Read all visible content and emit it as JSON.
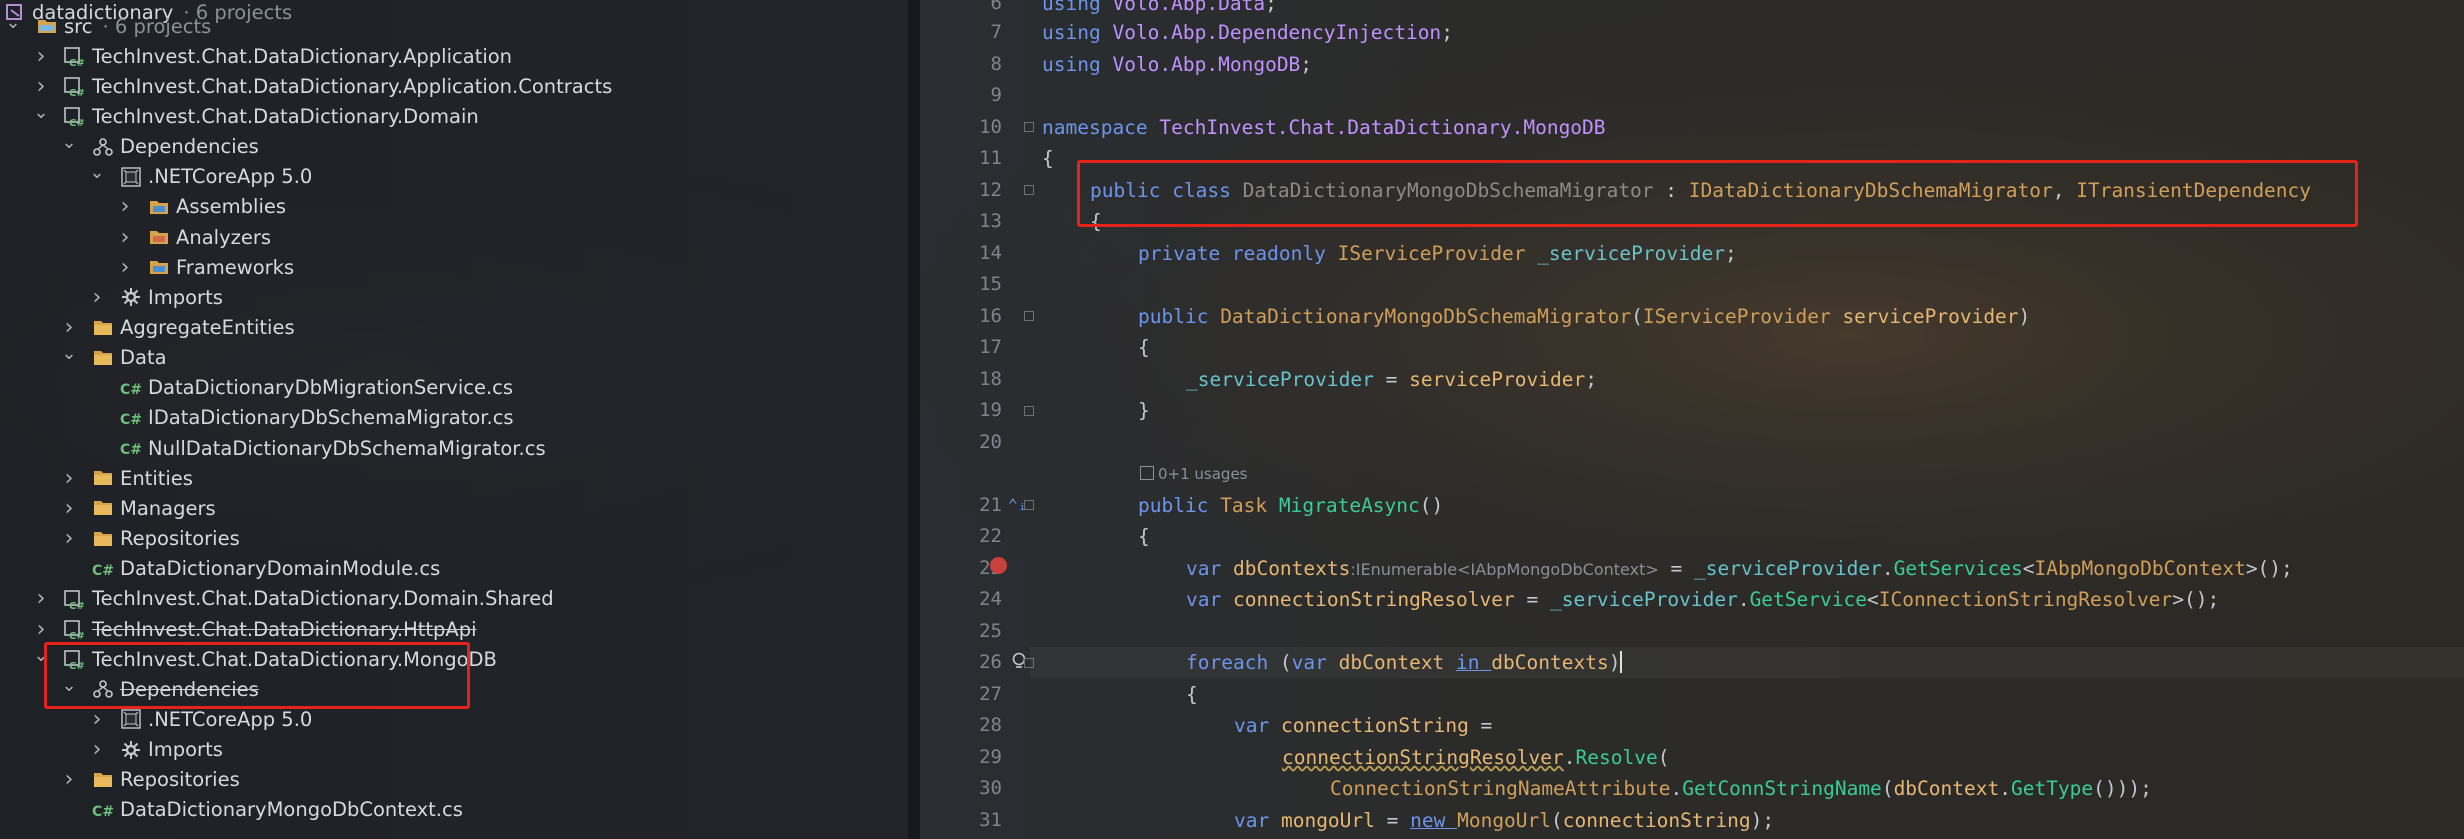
{
  "tree": {
    "root": {
      "label": "datadictionary",
      "count": "· 6 projects"
    },
    "rows": [
      {
        "indent": 0,
        "arrow": "down",
        "icon": "folder-src-icon",
        "label": "src",
        "meta": "· 6 projects"
      },
      {
        "indent": 1,
        "arrow": "right",
        "icon": "csharp-project-icon",
        "label": "TechInvest.Chat.DataDictionary.Application"
      },
      {
        "indent": 1,
        "arrow": "right",
        "icon": "csharp-project-icon",
        "label": "TechInvest.Chat.DataDictionary.Application.Contracts"
      },
      {
        "indent": 1,
        "arrow": "down",
        "icon": "csharp-project-icon",
        "label": "TechInvest.Chat.DataDictionary.Domain"
      },
      {
        "indent": 2,
        "arrow": "down",
        "icon": "dependencies-icon",
        "label": "Dependencies"
      },
      {
        "indent": 3,
        "arrow": "down",
        "icon": "netcore-icon",
        "label": ".NETCoreApp 5.0"
      },
      {
        "indent": 4,
        "arrow": "right",
        "icon": "assemblies-icon",
        "label": "Assemblies"
      },
      {
        "indent": 4,
        "arrow": "right",
        "icon": "analyzers-icon",
        "label": "Analyzers"
      },
      {
        "indent": 4,
        "arrow": "right",
        "icon": "frameworks-icon",
        "label": "Frameworks"
      },
      {
        "indent": 3,
        "arrow": "right",
        "icon": "imports-gear-icon",
        "label": "Imports"
      },
      {
        "indent": 2,
        "arrow": "right",
        "icon": "folder-icon",
        "label": "AggregateEntities"
      },
      {
        "indent": 2,
        "arrow": "down",
        "icon": "folder-icon",
        "label": "Data"
      },
      {
        "indent": 3,
        "arrow": "none",
        "icon": "csharp-file-icon",
        "label": "DataDictionaryDbMigrationService.cs"
      },
      {
        "indent": 3,
        "arrow": "none",
        "icon": "csharp-file-icon",
        "label": "IDataDictionaryDbSchemaMigrator.cs"
      },
      {
        "indent": 3,
        "arrow": "none",
        "icon": "csharp-file-icon",
        "label": "NullDataDictionaryDbSchemaMigrator.cs"
      },
      {
        "indent": 2,
        "arrow": "right",
        "icon": "folder-icon",
        "label": "Entities"
      },
      {
        "indent": 2,
        "arrow": "right",
        "icon": "folder-icon",
        "label": "Managers"
      },
      {
        "indent": 2,
        "arrow": "right",
        "icon": "folder-icon",
        "label": "Repositories"
      },
      {
        "indent": 2,
        "arrow": "none",
        "icon": "csharp-file-icon",
        "label": "DataDictionaryDomainModule.cs"
      },
      {
        "indent": 1,
        "arrow": "right",
        "icon": "csharp-project-icon",
        "label": "TechInvest.Chat.DataDictionary.Domain.Shared"
      },
      {
        "indent": 1,
        "arrow": "right",
        "icon": "csharp-project-icon",
        "label": "TechInvest.Chat.DataDictionary.HttpApi",
        "struck": true
      },
      {
        "indent": 1,
        "arrow": "down",
        "icon": "csharp-project-icon",
        "label": "TechInvest.Chat.DataDictionary.MongoDB"
      },
      {
        "indent": 2,
        "arrow": "down",
        "icon": "dependencies-icon",
        "label": "Dependencies",
        "struck": true
      },
      {
        "indent": 3,
        "arrow": "right",
        "icon": "netcore-icon",
        "label": ".NETCoreApp 5.0"
      },
      {
        "indent": 3,
        "arrow": "right",
        "icon": "imports-gear-icon",
        "label": "Imports"
      },
      {
        "indent": 2,
        "arrow": "right",
        "icon": "folder-icon",
        "label": "Repositories"
      },
      {
        "indent": 2,
        "arrow": "none",
        "icon": "csharp-file-icon",
        "label": "DataDictionaryMongoDbContext.cs"
      }
    ]
  },
  "editor": {
    "line_numbers": [
      "6",
      "7",
      "8",
      "9",
      "10",
      "11",
      "12",
      "13",
      "14",
      "15",
      "16",
      "17",
      "18",
      "19",
      "20",
      "21",
      "22",
      "23",
      "24",
      "25",
      "26",
      "27",
      "28",
      "29",
      "30",
      "31"
    ],
    "usages_hint": "0+1 usages",
    "inlay_hint": ":IEnumerable<IAbpMongoDbContext>",
    "code": {
      "l6": [
        "using ",
        "Volo.Abp.Data",
        ";"
      ],
      "l7": [
        "using ",
        "Volo.Abp.DependencyInjection",
        ";"
      ],
      "l8": [
        "using ",
        "Volo.Abp.MongoDB",
        ";"
      ],
      "l10": [
        "namespace ",
        "TechInvest.Chat.DataDictionary.MongoDB"
      ],
      "l11": "{",
      "l12": [
        "public ",
        "class ",
        "DataDictionaryMongoDbSchemaMigrator",
        " : ",
        "IDataDictionaryDbSchemaMigrator",
        ", ",
        "ITransientDependency"
      ],
      "l13": "{",
      "l14": [
        "private ",
        "readonly ",
        "IServiceProvider",
        " ",
        "_serviceProvider",
        ";"
      ],
      "l16": [
        "public ",
        "DataDictionaryMongoDbSchemaMigrator",
        "(",
        "IServiceProvider",
        " ",
        "serviceProvider",
        ")"
      ],
      "l17": "{",
      "l18": [
        "_serviceProvider",
        " = ",
        "serviceProvider",
        ";"
      ],
      "l19": "}",
      "l21": [
        "public ",
        "Task ",
        "MigrateAsync",
        "()"
      ],
      "l22": "{",
      "l23": [
        "var ",
        "dbContexts",
        " = ",
        "_serviceProvider",
        ".",
        "GetServices",
        "<",
        "IAbpMongoDbContext",
        ">();"
      ],
      "l24": [
        "var ",
        "connectionStringResolver",
        " = ",
        "_serviceProvider",
        ".",
        "GetService",
        "<",
        "IConnectionStringResolver",
        ">();"
      ],
      "l26": [
        "foreach ",
        "(",
        "var ",
        "dbContext ",
        "in ",
        "dbContexts",
        ")"
      ],
      "l27": "{",
      "l28": [
        "var ",
        "connectionString",
        " ="
      ],
      "l29": [
        "connectionStringResolver",
        ".",
        "Resolve",
        "("
      ],
      "l30": [
        "ConnectionStringNameAttribute",
        ".",
        "GetConnStringName",
        "(",
        "dbContext",
        ".",
        "GetType",
        "()));"
      ],
      "l31": [
        "var ",
        "mongoUrl",
        " = ",
        "new ",
        "MongoUrl",
        "(",
        "connectionString",
        ");"
      ]
    }
  },
  "colors": {
    "highlight_box": "#e5231b",
    "keyword": "#6c95eb",
    "namespace": "#c191ff",
    "type": "#d09f5a",
    "method": "#39cc9b",
    "field": "#66c3cc"
  }
}
